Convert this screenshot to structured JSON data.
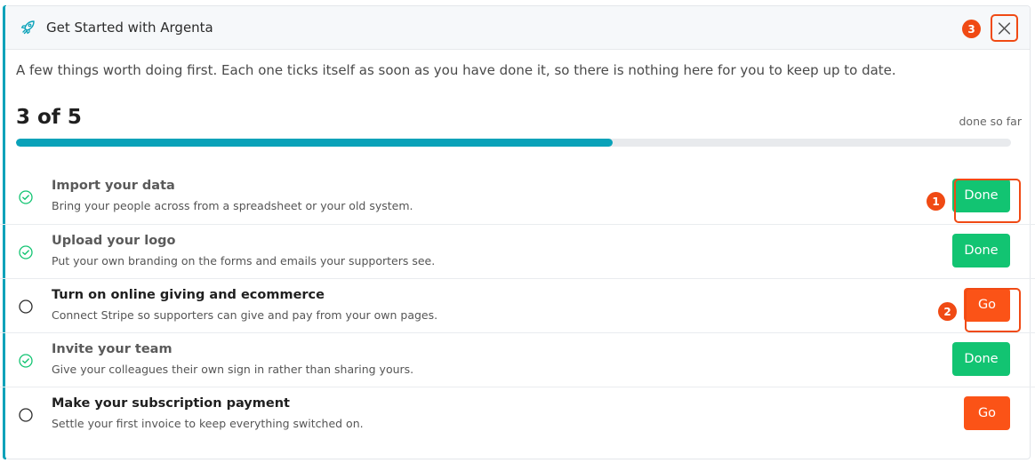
{
  "panel": {
    "title": "Get Started with Argenta",
    "intro": "A few things worth doing first. Each one ticks itself as soon as you have done it, so there is nothing here for you to keep up to date."
  },
  "progress": {
    "count_text": "3 of 5",
    "label": "done so far",
    "fraction": 0.6
  },
  "tasks": [
    {
      "title": "Import your data",
      "description": "Bring your people across from a spreadsheet or your old system.",
      "status": "done",
      "button": "Done"
    },
    {
      "title": "Upload your logo",
      "description": "Put your own branding on the forms and emails your supporters see.",
      "status": "done",
      "button": "Done"
    },
    {
      "title": "Turn on online giving and ecommerce",
      "description": "Connect Stripe so supporters can give and pay from your own pages.",
      "status": "todo",
      "button": "Go"
    },
    {
      "title": "Invite your team",
      "description": "Give your colleagues their own sign in rather than sharing yours.",
      "status": "done",
      "button": "Done"
    },
    {
      "title": "Make your subscription payment",
      "description": "Settle your first invoice to keep everything switched on.",
      "status": "todo",
      "button": "Go"
    }
  ],
  "annotations": [
    "1",
    "2",
    "3"
  ],
  "colors": {
    "accent": "#0aa2b9",
    "done_green": "#12c472",
    "go_orange": "#fb5317",
    "annotation_red": "#f04a14"
  }
}
